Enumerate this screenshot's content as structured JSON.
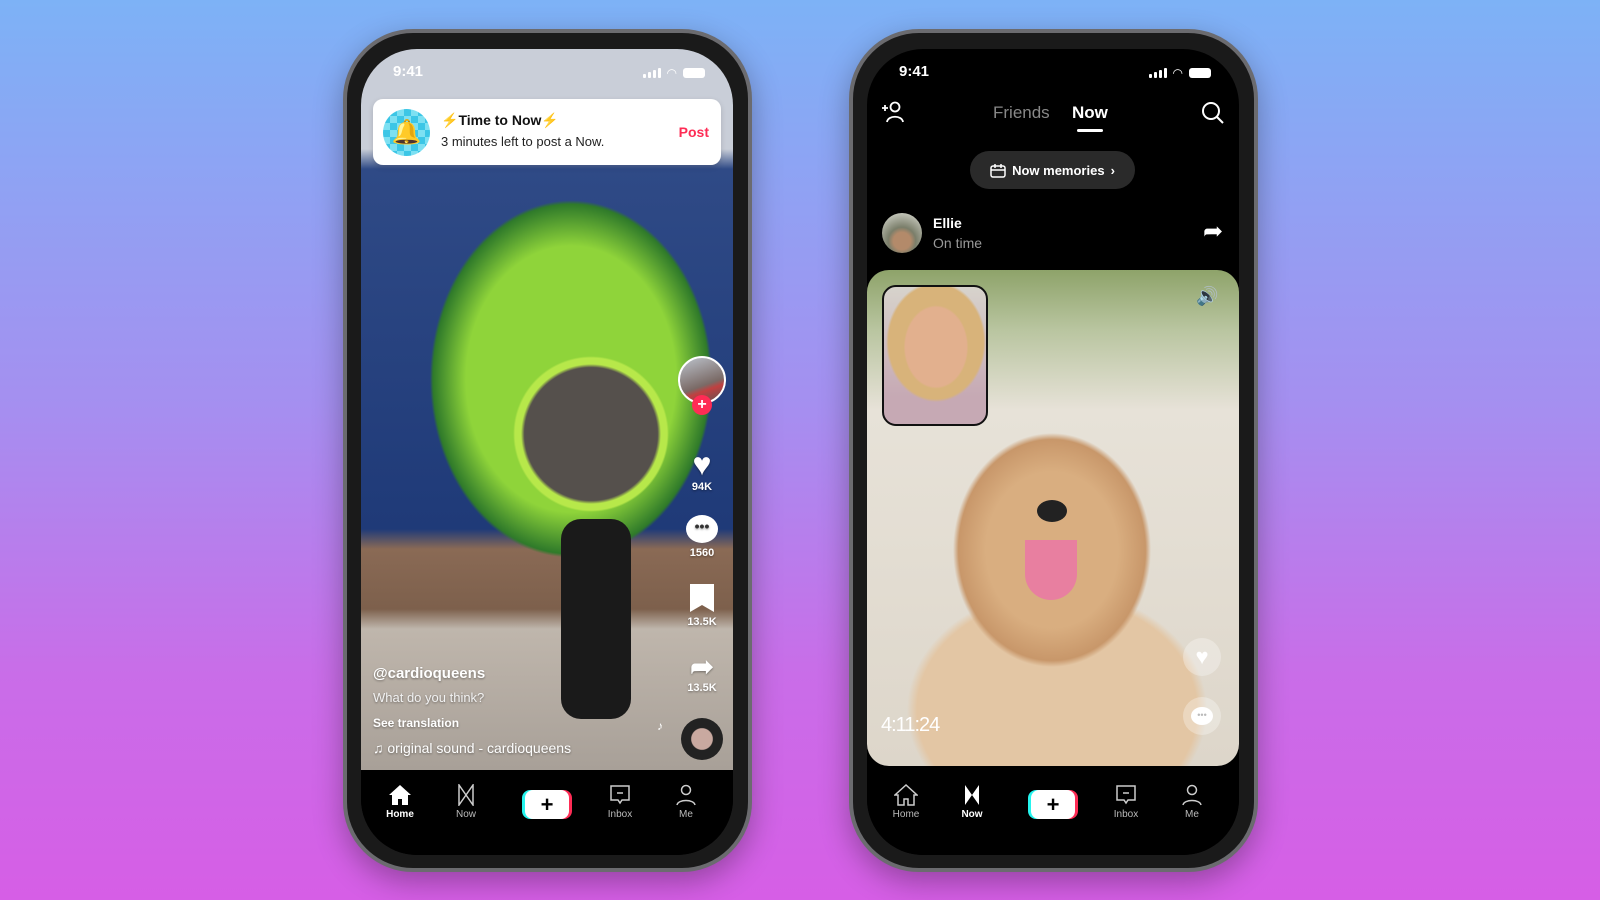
{
  "left_phone": {
    "status_time": "9:41",
    "notification": {
      "title": "Time to Now",
      "subtitle": "3 minutes left to post a Now.",
      "action": "Post",
      "icon": "bell-icon",
      "bolt": "⚡"
    },
    "actions": {
      "likes": "94K",
      "comments": "1560",
      "saves": "13.5K",
      "shares": "13.5K"
    },
    "caption": {
      "username": "@cardioqueens",
      "text": "What do you think?",
      "translate": "See translation",
      "sound": "original sound - cardioqueens"
    },
    "nav": [
      {
        "label": "Home",
        "icon": "home-icon",
        "active": true
      },
      {
        "label": "Now",
        "icon": "now-icon"
      },
      {
        "label": "",
        "icon": "plus-icon"
      },
      {
        "label": "Inbox",
        "icon": "inbox-icon"
      },
      {
        "label": "Me",
        "icon": "profile-icon"
      }
    ]
  },
  "right_phone": {
    "status_time": "9:41",
    "tabs": [
      {
        "label": "Friends"
      },
      {
        "label": "Now",
        "active": true
      }
    ],
    "memories_label": "Now memories",
    "post": {
      "name": "Ellie",
      "status": "On time",
      "timestamp": "4:11:24"
    },
    "nav": [
      {
        "label": "Home",
        "icon": "home-icon"
      },
      {
        "label": "Now",
        "icon": "now-icon",
        "active": true
      },
      {
        "label": "",
        "icon": "plus-icon"
      },
      {
        "label": "Inbox",
        "icon": "inbox-icon"
      },
      {
        "label": "Me",
        "icon": "profile-icon"
      }
    ]
  },
  "colors": {
    "accent": "#fe2c55",
    "cyan": "#25f4ee",
    "bolt": "#f5c518"
  }
}
